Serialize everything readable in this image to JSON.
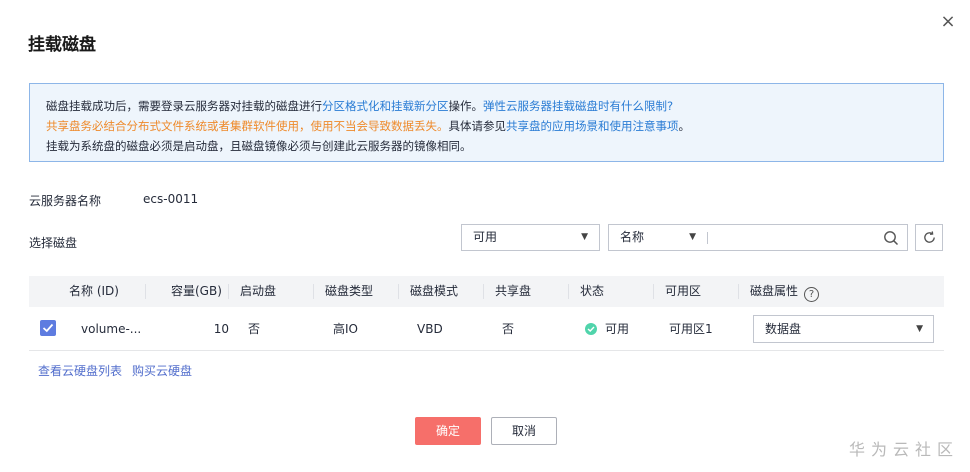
{
  "dialog": {
    "title": "挂载磁盘",
    "close_glyph": "×"
  },
  "notice": {
    "line1_text": "磁盘挂载成功后，需要登录云服务器对挂载的磁盘进行",
    "line1_link1": "分区格式化和挂载新分区",
    "line1_after": "操作。",
    "line1_link2": "弹性云服务器挂载磁盘时有什么限制?",
    "line2_warn": "共享盘务必结合分布式文件系统或者集群软件使用，使用不当会导致数据丢失。",
    "line2_text": "具体请参见",
    "line2_link": "共享盘的应用场景和使用注意事项",
    "line2_end": "。",
    "line3": "挂载为系统盘的磁盘必须是启动盘，且磁盘镜像必须与创建此云服务器的镜像相同。"
  },
  "server": {
    "label": "云服务器名称",
    "value": "ecs-0011"
  },
  "disk_select": {
    "label": "选择磁盘",
    "status_filter": "可用",
    "search_field": "名称",
    "search_value": ""
  },
  "table": {
    "headers": [
      "名称 (ID)",
      "容量(GB)",
      "启动盘",
      "磁盘类型",
      "磁盘模式",
      "共享盘",
      "状态",
      "可用区",
      "磁盘属性"
    ],
    "rows": [
      {
        "name": "volume-...",
        "capacity": "10",
        "bootable": "否",
        "disk_type": "高IO",
        "disk_mode": "VBD",
        "shared": "否",
        "status": "可用",
        "az": "可用区1",
        "attribute": "数据盘"
      }
    ]
  },
  "links": {
    "view_list": "查看云硬盘列表",
    "buy": "购买云硬盘"
  },
  "footer": {
    "ok": "确定",
    "cancel": "取消"
  },
  "watermark": "华为云社区",
  "colors": {
    "accent": "#5e7ce0",
    "primary_button": "#f66f6a",
    "link": "#2a7cd4",
    "warning_text": "#ee8a2b",
    "status_ok": "#50d4ab"
  }
}
